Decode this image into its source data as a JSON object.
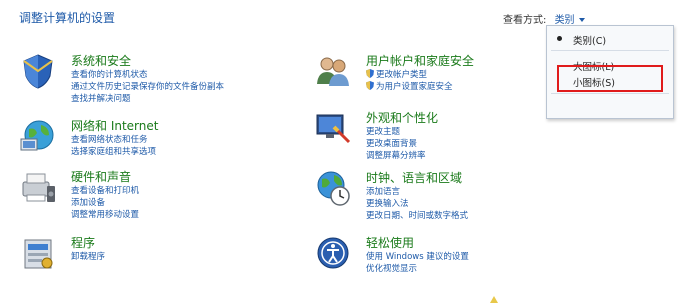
{
  "header": {
    "title": "调整计算机的设置",
    "view_by_label": "查看方式:",
    "view_by_value": "类别"
  },
  "categories": [
    {
      "title": "系统和安全",
      "icon": "system-security-icon",
      "links": [
        "查看你的计算机状态",
        "通过文件历史记录保存你的文件备份副本",
        "查找并解决问题"
      ]
    },
    {
      "title": "网络和 Internet",
      "icon": "network-icon",
      "links": [
        "查看网络状态和任务",
        "选择家庭组和共享选项"
      ]
    },
    {
      "title": "硬件和声音",
      "icon": "hardware-sound-icon",
      "links": [
        "查看设备和打印机",
        "添加设备",
        "调整常用移动设置"
      ]
    },
    {
      "title": "程序",
      "icon": "programs-icon",
      "links": [
        "卸载程序"
      ]
    },
    {
      "title": "用户帐户和家庭安全",
      "icon": "user-accounts-icon",
      "links": [
        "更改帐户类型",
        "为用户设置家庭安全"
      ]
    },
    {
      "title": "外观和个性化",
      "icon": "appearance-icon",
      "links": [
        "更改主题",
        "更改桌面背景",
        "调整屏幕分辨率"
      ]
    },
    {
      "title": "时钟、语言和区域",
      "icon": "clock-language-region-icon",
      "links": [
        "添加语言",
        "更换输入法",
        "更改日期、时间或数字格式"
      ]
    },
    {
      "title": "轻松使用",
      "icon": "ease-of-access-icon",
      "links": [
        "使用 Windows 建议的设置",
        "优化视觉显示"
      ]
    }
  ],
  "view_menu": {
    "items": [
      "类别(C)",
      "大图标(L)",
      "小图标(S)"
    ],
    "selected": "类别(C)",
    "highlighted": "小图标(S)"
  },
  "colors": {
    "link": "#1e5aa8",
    "category_title": "#1a7a1a",
    "highlight_box": "#e01b1b"
  }
}
